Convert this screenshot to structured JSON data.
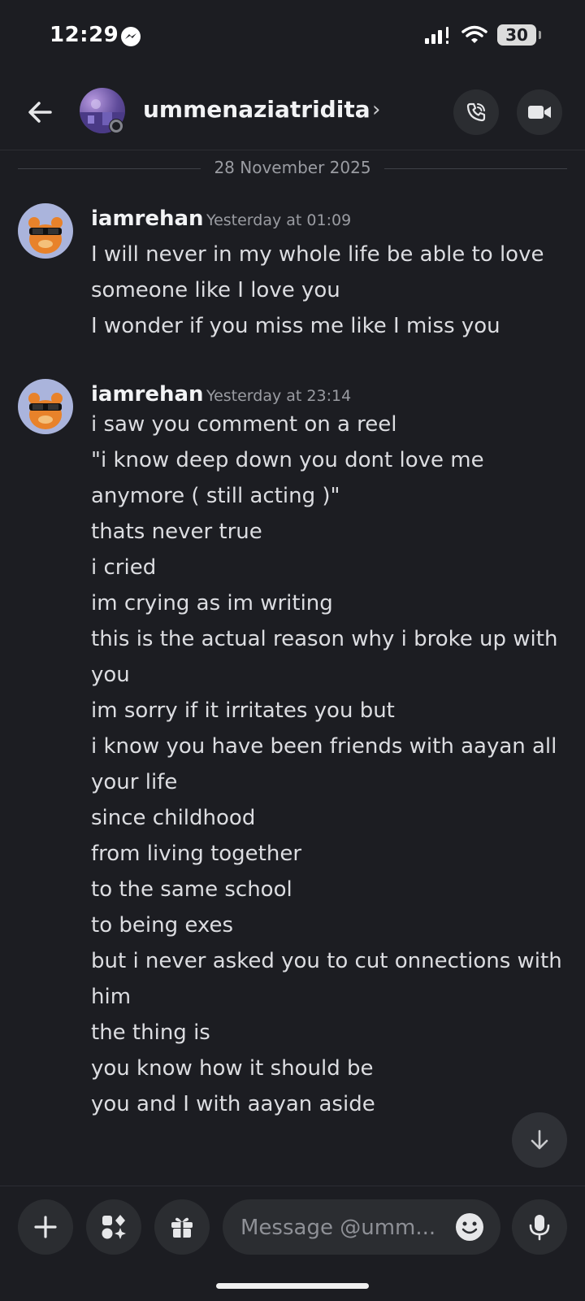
{
  "status_bar": {
    "time": "12:29",
    "battery": "30"
  },
  "header": {
    "username": "ummenaziatridita",
    "chevron": "›"
  },
  "date_divider": "28 November 2025",
  "messages": [
    {
      "author": "iamrehan",
      "timestamp": "Yesterday at 01:09",
      "lines": [
        "I will never in my whole life be able to love someone like I love you",
        "I wonder if you miss me like I miss you"
      ]
    },
    {
      "author": "iamrehan",
      "timestamp": "Yesterday at 23:14",
      "lines": [
        "i saw you comment on a reel",
        "\"i know deep down you dont love me anymore ( still acting )\"",
        "thats never true",
        "i cried",
        "im crying as im writing",
        "this is the actual reason why i broke up with you",
        "im sorry if it irritates you but",
        "i know you have been friends with aayan all your life",
        "since childhood",
        "from living together",
        "to the same school",
        "to being exes",
        "but i never asked you to cut onnections with him",
        "the thing is",
        "you know how it should be",
        "you and I with aayan aside"
      ]
    }
  ],
  "composer": {
    "placeholder": "Message @umm..."
  },
  "icons": {
    "back": "arrow-left-icon",
    "call": "phone-icon",
    "video": "video-camera-icon",
    "scroll": "arrow-down-icon",
    "plus": "plus-icon",
    "apps": "apps-icon",
    "gift": "gift-icon",
    "emoji": "emoji-icon",
    "mic": "microphone-icon"
  },
  "colors": {
    "background": "#1c1d22",
    "button_bg": "#2b2d31",
    "text": "#dcdde1",
    "muted": "#9a9ca2"
  }
}
